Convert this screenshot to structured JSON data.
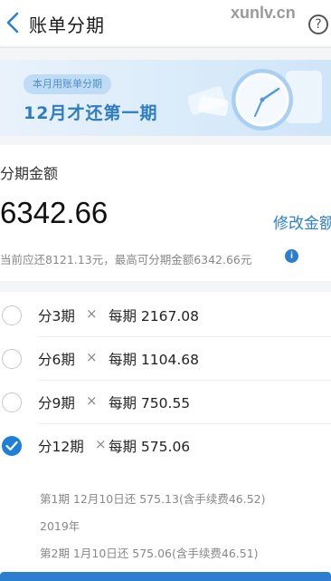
{
  "header": {
    "title": "账单分期",
    "watermark": "xunlv.cn",
    "help_glyph": "?"
  },
  "banner": {
    "pill": "本月用账单分期",
    "main": "12月才还第一期"
  },
  "amount_card": {
    "label": "分期金额",
    "amount": "6342.66",
    "modify_label": "修改金额",
    "hint": "当前应还8121.13元，最高可分期金额6342.66元",
    "info_glyph": "i"
  },
  "options": [
    {
      "term": "分3期",
      "times": "×",
      "per": "每期 2167.08",
      "checked": false
    },
    {
      "term": "分6期",
      "times": "×",
      "per": "每期 1104.68",
      "checked": false
    },
    {
      "term": "分9期",
      "times": "×",
      "per": "每期 750.55",
      "checked": false
    },
    {
      "term": "分12期",
      "times": "×",
      "per": "每期 575.06",
      "checked": true
    }
  ],
  "schedule": [
    {
      "text": "第1期    12月10日还 575.13(含手续费46.52)"
    },
    {
      "text": "2019年"
    },
    {
      "text": "第2期    1月10日还 575.06(含手续费46.51)"
    }
  ],
  "colors": {
    "accent": "#2c7fd0",
    "banner_text": "#2e7cc3"
  }
}
